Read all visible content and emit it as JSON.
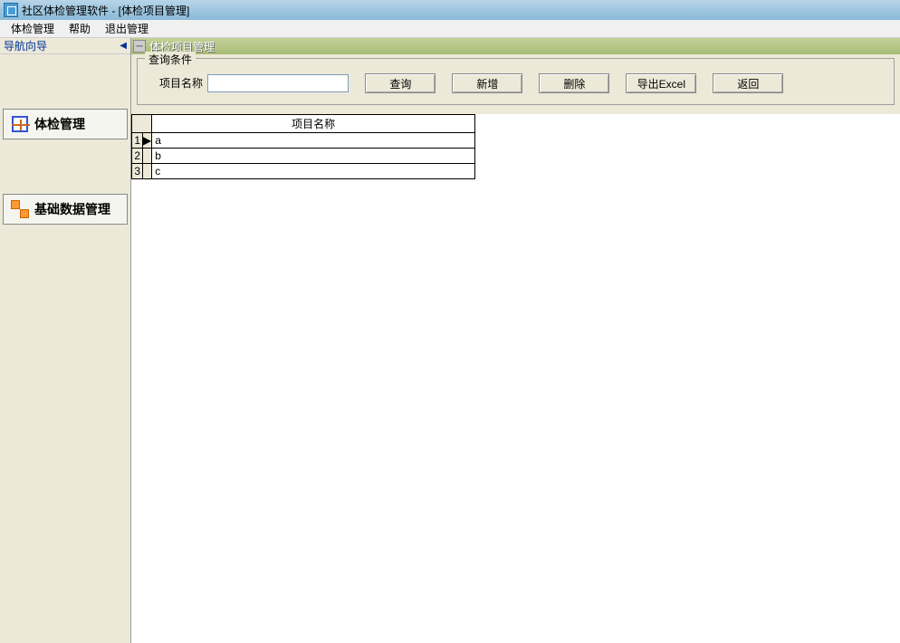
{
  "app": {
    "title": "社区体检管理软件  - [体检项目管理]"
  },
  "menubar": {
    "items": [
      "体检管理",
      "帮助",
      "退出管理"
    ]
  },
  "sidebar": {
    "header": "导航向导",
    "items": [
      {
        "label": "体检管理",
        "icon": "physical-icon"
      },
      {
        "label": "基础数据管理",
        "icon": "data-icon"
      }
    ]
  },
  "tab": {
    "title": "体检项目管理"
  },
  "search": {
    "legend": "查询条件",
    "label": "项目名称",
    "value": "",
    "buttons": {
      "query": "查询",
      "add": "新增",
      "delete": "删除",
      "export": "导出Excel",
      "back": "返回"
    }
  },
  "grid": {
    "header": "项目名称",
    "rows": [
      {
        "num": "1",
        "marker": "▶",
        "name": "a"
      },
      {
        "num": "2",
        "marker": "",
        "name": "b"
      },
      {
        "num": "3",
        "marker": "",
        "name": "c"
      }
    ]
  }
}
